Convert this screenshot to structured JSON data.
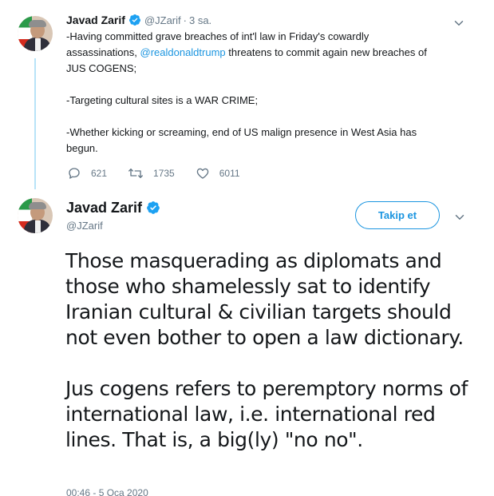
{
  "tweet1": {
    "name": "Javad Zarif",
    "handle": "@JZarif",
    "separator": "·",
    "time": "3 sa.",
    "line1": "-Having committed grave breaches of int'l law in Friday's cowardly",
    "line2_pre": "assassinations, ",
    "mention": "@realdonaldtrump",
    "line2_post": " threatens to commit again new breaches of",
    "line3": "JUS COGENS;",
    "para2": "-Targeting cultural sites is a WAR CRIME;",
    "para3": "-Whether kicking or screaming, end of US malign presence in West Asia has begun.",
    "replies": "621",
    "retweets": "1735",
    "likes": "6011"
  },
  "tweet2": {
    "name": "Javad Zarif",
    "handle": "@JZarif",
    "follow_label": "Takip et",
    "para1": "Those masquerading as diplomats and those who shamelessly sat to identify Iranian cultural & civilian targets should not even bother to open a law dictionary.",
    "para2": "Jus cogens refers to peremptory norms of international law, i.e. international red lines. That is, a big(ly) \"no no\".",
    "timestamp": "00:46 - 5 Oca 2020"
  },
  "colors": {
    "accent": "#1b95e0",
    "thread_line": "#b8e3f8",
    "secondary_text": "#657786",
    "primary_text": "#14171a"
  }
}
